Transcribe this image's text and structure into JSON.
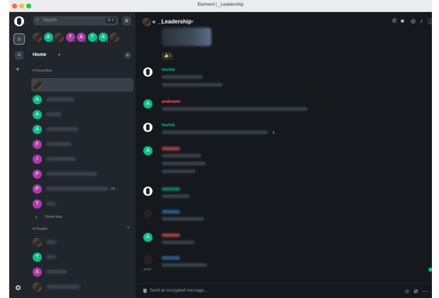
{
  "window": {
    "title": "Element | _Leadership"
  },
  "colors": {
    "accent": "#0dbd8b",
    "green": "#0dbd8b",
    "purple": "#ac3ba8",
    "red": "#ff5b55",
    "blue": "#368bd6"
  },
  "search": {
    "placeholder": "Search",
    "shortcut": "⌘ K"
  },
  "space_rail": {
    "space_letter": "A",
    "add": "+"
  },
  "breadcrumbs": [
    {
      "letter": "",
      "color": "photo"
    },
    {
      "letter": "A",
      "color": "#0dbd8b"
    },
    {
      "letter": "",
      "color": "photo"
    },
    {
      "letter": "T",
      "color": "#ac3ba8"
    },
    {
      "letter": "A",
      "color": "#ac3ba8"
    },
    {
      "letter": "T",
      "color": "#0dbd8b"
    },
    {
      "letter": "A",
      "color": "#0dbd8b"
    },
    {
      "letter": "",
      "color": "photo"
    }
  ],
  "home": {
    "label": "Home",
    "plus": "+"
  },
  "favorites": {
    "header": "Favorites",
    "rooms": [
      {
        "letter": "",
        "color": "photo",
        "name_width": 30,
        "selected": true
      },
      {
        "letter": "A",
        "color": "#0dbd8b",
        "name_width": 40
      },
      {
        "letter": "A",
        "color": "#0dbd8b",
        "name_width": 22
      },
      {
        "letter": "A",
        "color": "#0dbd8b",
        "name_width": 46
      },
      {
        "letter": "F",
        "color": "#ac3ba8",
        "name_width": 36
      },
      {
        "letter": "I",
        "color": "#ac3ba8",
        "name_width": 42
      },
      {
        "letter": "P",
        "color": "#ac3ba8",
        "name_width": 72
      },
      {
        "letter": "P",
        "color": "#ac3ba8",
        "name_width": 88,
        "suffix": "yp..."
      },
      {
        "letter": "T",
        "color": "#ac3ba8",
        "name_width": 14
      }
    ],
    "show_less": "Show less"
  },
  "people": {
    "header": "People",
    "rooms": [
      {
        "letter": "",
        "color": "photo",
        "name_width": 14
      },
      {
        "letter": "T",
        "color": "#0dbd8b",
        "name_width": 14
      },
      {
        "letter": "A",
        "color": "#ac3ba8",
        "name_width": 30
      },
      {
        "letter": "",
        "color": "photo",
        "name_width": 48
      }
    ]
  },
  "room": {
    "title": "_Leadership",
    "composer_placeholder": "Send an encrypted message..."
  },
  "reaction": {
    "emoji": "👍",
    "count": "1"
  },
  "messages": [
    {
      "sender": "kevink",
      "sender_color": "#0dbd8b",
      "avatar_letter": "",
      "avatar": "portrait",
      "lines": [
        58,
        86
      ]
    },
    {
      "sender": "andrewm",
      "sender_color": "#ff5b55",
      "avatar_letter": "A",
      "avatar": "#0dbd8b",
      "lines": [
        206
      ]
    },
    {
      "sender": "kevink",
      "sender_color": "#0dbd8b",
      "avatar_letter": "",
      "avatar": "portrait",
      "lines": [
        150
      ]
    },
    {
      "sender": "",
      "sender_color": "#ff5b55",
      "avatar_letter": "A",
      "avatar": "#0dbd8b",
      "lines": [
        56,
        62,
        48
      ]
    },
    {
      "sender": "",
      "sender_color": "#0dbd8b",
      "avatar_letter": "",
      "avatar": "portrait",
      "lines": [
        40
      ]
    },
    {
      "sender": "",
      "sender_color": "#368bd6",
      "avatar_letter": "",
      "avatar": "dark",
      "lines": [
        60
      ]
    },
    {
      "sender": "",
      "sender_color": "#ff5b55",
      "avatar_letter": "A",
      "avatar": "#0dbd8b",
      "lines": [
        46
      ]
    },
    {
      "sender": "",
      "sender_color": "#368bd6",
      "avatar_letter": "",
      "avatar": "dark",
      "lines": [
        64
      ]
    }
  ],
  "last_timestamp": "13:19",
  "icons": {
    "search": "search-icon",
    "explore": "compass-icon",
    "call": "phone-icon",
    "video": "video-icon",
    "threads": "threads-icon",
    "notifications": "bell-icon",
    "info": "info-icon",
    "emoji": "smiley-icon",
    "attach": "paperclip-icon",
    "more": "ellipsis-icon"
  }
}
